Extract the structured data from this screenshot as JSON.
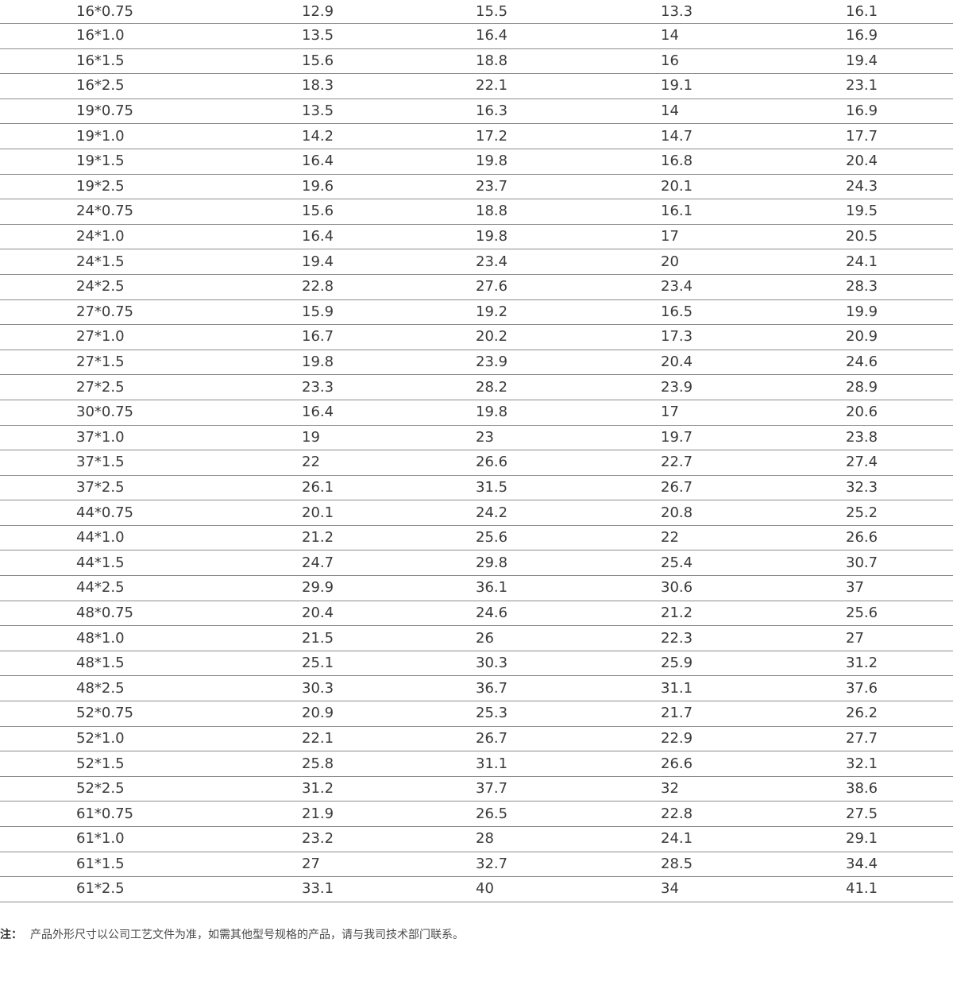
{
  "table": {
    "rows": [
      [
        "16*0.75",
        "12.9",
        "15.5",
        "13.3",
        "16.1"
      ],
      [
        "16*1.0",
        "13.5",
        "16.4",
        "14",
        "16.9"
      ],
      [
        "16*1.5",
        "15.6",
        "18.8",
        "16",
        "19.4"
      ],
      [
        "16*2.5",
        "18.3",
        "22.1",
        "19.1",
        "23.1"
      ],
      [
        "19*0.75",
        "13.5",
        "16.3",
        "14",
        "16.9"
      ],
      [
        "19*1.0",
        "14.2",
        "17.2",
        "14.7",
        "17.7"
      ],
      [
        "19*1.5",
        "16.4",
        "19.8",
        "16.8",
        "20.4"
      ],
      [
        "19*2.5",
        "19.6",
        "23.7",
        "20.1",
        "24.3"
      ],
      [
        "24*0.75",
        "15.6",
        "18.8",
        "16.1",
        "19.5"
      ],
      [
        "24*1.0",
        "16.4",
        "19.8",
        "17",
        "20.5"
      ],
      [
        "24*1.5",
        "19.4",
        "23.4",
        "20",
        "24.1"
      ],
      [
        "24*2.5",
        "22.8",
        "27.6",
        "23.4",
        "28.3"
      ],
      [
        "27*0.75",
        "15.9",
        "19.2",
        "16.5",
        "19.9"
      ],
      [
        "27*1.0",
        "16.7",
        "20.2",
        "17.3",
        "20.9"
      ],
      [
        "27*1.5",
        "19.8",
        "23.9",
        "20.4",
        "24.6"
      ],
      [
        "27*2.5",
        "23.3",
        "28.2",
        "23.9",
        "28.9"
      ],
      [
        "30*0.75",
        "16.4",
        "19.8",
        "17",
        "20.6"
      ],
      [
        "37*1.0",
        "19",
        "23",
        "19.7",
        "23.8"
      ],
      [
        "37*1.5",
        "22",
        "26.6",
        "22.7",
        "27.4"
      ],
      [
        "37*2.5",
        "26.1",
        "31.5",
        "26.7",
        "32.3"
      ],
      [
        "44*0.75",
        "20.1",
        "24.2",
        "20.8",
        "25.2"
      ],
      [
        "44*1.0",
        "21.2",
        "25.6",
        "22",
        "26.6"
      ],
      [
        "44*1.5",
        "24.7",
        "29.8",
        "25.4",
        "30.7"
      ],
      [
        "44*2.5",
        "29.9",
        "36.1",
        "30.6",
        "37"
      ],
      [
        "48*0.75",
        "20.4",
        "24.6",
        "21.2",
        "25.6"
      ],
      [
        "48*1.0",
        "21.5",
        "26",
        "22.3",
        "27"
      ],
      [
        "48*1.5",
        "25.1",
        "30.3",
        "25.9",
        "31.2"
      ],
      [
        "48*2.5",
        "30.3",
        "36.7",
        "31.1",
        "37.6"
      ],
      [
        "52*0.75",
        "20.9",
        "25.3",
        "21.7",
        "26.2"
      ],
      [
        "52*1.0",
        "22.1",
        "26.7",
        "22.9",
        "27.7"
      ],
      [
        "52*1.5",
        "25.8",
        "31.1",
        "26.6",
        "32.1"
      ],
      [
        "52*2.5",
        "31.2",
        "37.7",
        "32",
        "38.6"
      ],
      [
        "61*0.75",
        "21.9",
        "26.5",
        "22.8",
        "27.5"
      ],
      [
        "61*1.0",
        "23.2",
        "28",
        "24.1",
        "29.1"
      ],
      [
        "61*1.5",
        "27",
        "32.7",
        "28.5",
        "34.4"
      ],
      [
        "61*2.5",
        "33.1",
        "40",
        "34",
        "41.1"
      ]
    ]
  },
  "note": {
    "label": "注：",
    "text": "产品外形尺寸以公司工艺文件为准，如需其他型号规格的产品，请与我司技术部门联系。"
  }
}
